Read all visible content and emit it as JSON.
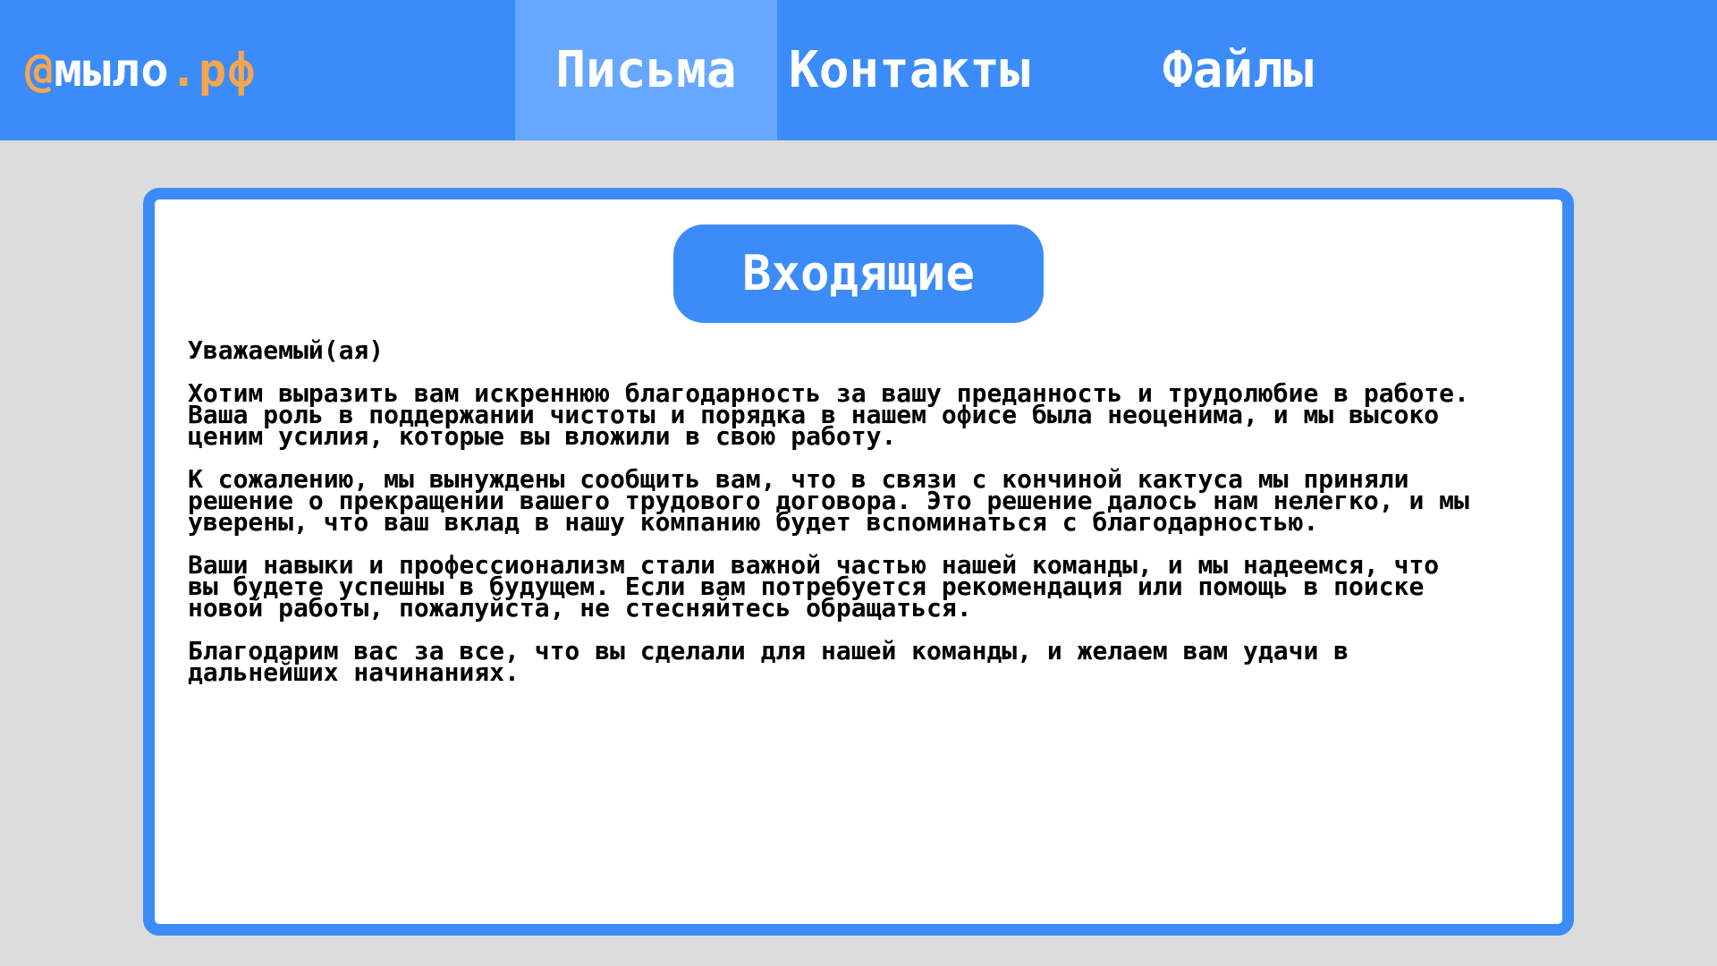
{
  "header": {
    "logo_at": "@",
    "logo_name": "мыло",
    "logo_dot": ".",
    "logo_tld": "рф",
    "tabs": [
      {
        "label": "Письма",
        "active": true
      },
      {
        "label": "Контакты",
        "active": false
      },
      {
        "label": "Файлы",
        "active": false
      }
    ]
  },
  "main": {
    "folder_title": "Входящие",
    "letter": {
      "greeting": "Уважаемый(ая)",
      "paragraphs": [
        "Хотим выразить вам искреннюю благодарность за вашу преданность и трудолюбие в работе. Ваша роль в поддержании чистоты и порядка в нашем офисе была неоценима, и мы высоко ценим усилия, которые вы вложили в свою работу.",
        "К сожалению, мы вынуждены сообщить вам, что в связи с кончиной кактуса мы приняли решение о прекращении вашего трудового договора. Это решение далось нам нелегко, и мы уверены, что ваш вклад в нашу компанию будет вспоминаться с благодарностью.",
        "Ваши навыки и профессионализм стали важной частью нашей команды, и мы надеемся, что вы будете успешны в будущем. Если вам потребуется рекомендация или помощь в поиске новой работы, пожалуйста, не стесняйтесь обращаться.",
        "Благодарим вас за все, что вы сделали для нашей команды, и желаем вам удачи в дальнейших начинаниях."
      ]
    }
  },
  "colors": {
    "header_bg": "#3b8cf8",
    "active_tab_bg": "#66a8ff",
    "logo_accent": "#f7a64d",
    "page_bg": "#dcdcdc",
    "panel_border": "#3b8cf8"
  }
}
